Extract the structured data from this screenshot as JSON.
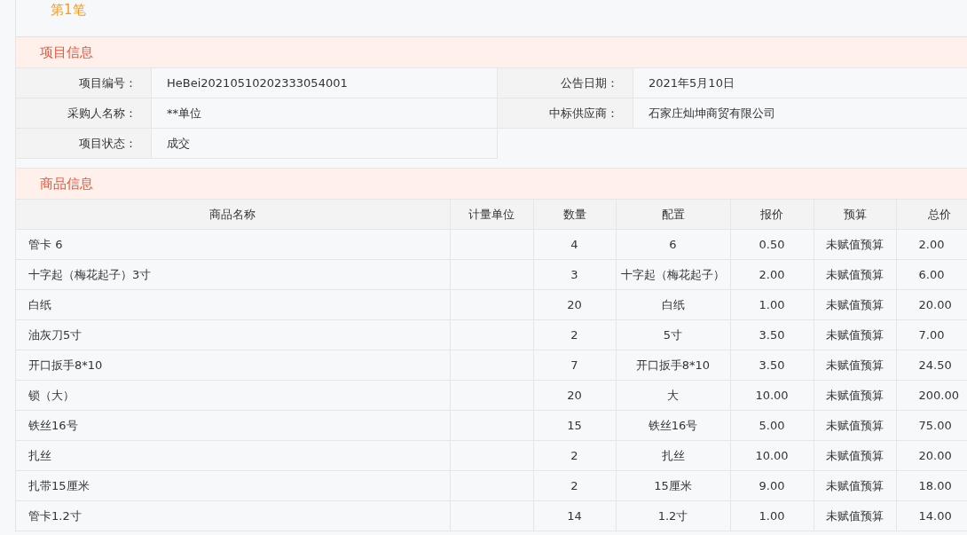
{
  "lot_title": "第1笔",
  "project_section": {
    "title": "项目信息",
    "fields": [
      {
        "label": "项目编号：",
        "value": "HeBei20210510202333054001"
      },
      {
        "label": "公告日期：",
        "value": "2021年5月10日"
      },
      {
        "label": "采购人名称：",
        "value": "**单位"
      },
      {
        "label": "中标供应商：",
        "value": "石家庄灿坤商贸有限公司"
      },
      {
        "label": "项目状态：",
        "value": "成交"
      }
    ]
  },
  "goods_section": {
    "title": "商品信息",
    "columns": [
      "商品名称",
      "计量单位",
      "数量",
      "配置",
      "报价",
      "预算",
      "总价"
    ],
    "rows": [
      {
        "name": "管卡 6",
        "quantity": "4",
        "config": "6",
        "price": "0.50",
        "budget": "未赋值预算",
        "total": "2.00"
      },
      {
        "name": "十字起（梅花起子）3寸",
        "quantity": "3",
        "config": "十字起（梅花起子）",
        "price": "2.00",
        "budget": "未赋值预算",
        "total": "6.00"
      },
      {
        "name": "白纸",
        "quantity": "20",
        "config": "白纸",
        "price": "1.00",
        "budget": "未赋值预算",
        "total": "20.00"
      },
      {
        "name": "油灰刀5寸",
        "quantity": "2",
        "config": "5寸",
        "price": "3.50",
        "budget": "未赋值预算",
        "total": "7.00"
      },
      {
        "name": "开口扳手8*10",
        "quantity": "7",
        "config": "开口扳手8*10",
        "price": "3.50",
        "budget": "未赋值预算",
        "total": "24.50"
      },
      {
        "name": "锁（大）",
        "quantity": "20",
        "config": "大",
        "price": "10.00",
        "budget": "未赋值预算",
        "total": "200.00"
      },
      {
        "name": "铁丝16号",
        "quantity": "15",
        "config": "铁丝16号",
        "price": "5.00",
        "budget": "未赋值预算",
        "total": "75.00"
      },
      {
        "name": "扎丝",
        "quantity": "2",
        "config": "扎丝",
        "price": "10.00",
        "budget": "未赋值预算",
        "total": "20.00"
      },
      {
        "name": "扎带15厘米",
        "quantity": "2",
        "config": "15厘米",
        "price": "9.00",
        "budget": "未赋值预算",
        "total": "18.00"
      },
      {
        "name": "管卡1.2寸",
        "quantity": "14",
        "config": "1.2寸",
        "price": "1.00",
        "budget": "未赋值预算",
        "total": "14.00"
      }
    ]
  }
}
